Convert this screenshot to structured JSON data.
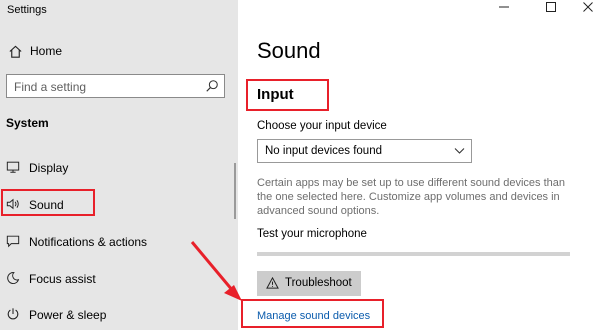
{
  "app": {
    "title": "Settings"
  },
  "window_controls": [
    "minimize-icon",
    "maximize-icon",
    "close-icon"
  ],
  "sidebar": {
    "home_label": "Home",
    "search_placeholder": "Find a setting",
    "section_title": "System",
    "items": [
      {
        "label": "Display",
        "icon": "monitor-icon"
      },
      {
        "label": "Sound",
        "icon": "speaker-icon",
        "selected": true
      },
      {
        "label": "Notifications & actions",
        "icon": "notification-icon"
      },
      {
        "label": "Focus assist",
        "icon": "moon-icon"
      },
      {
        "label": "Power & sleep",
        "icon": "power-icon"
      }
    ]
  },
  "main": {
    "title": "Sound",
    "input": {
      "heading": "Input",
      "choose_label": "Choose your input device",
      "device_value": "No input devices found",
      "description": "Certain apps may be set up to use different sound devices than the one selected here. Customize app volumes and devices in advanced sound options.",
      "mic_label": "Test your microphone",
      "mic_level": 0,
      "troubleshoot_label": "Troubleshoot",
      "manage_link": "Manage sound devices"
    }
  },
  "colors": {
    "highlight": "#e8202a",
    "link": "#0b5cad",
    "sidebar_bg": "#e6e6e6"
  }
}
